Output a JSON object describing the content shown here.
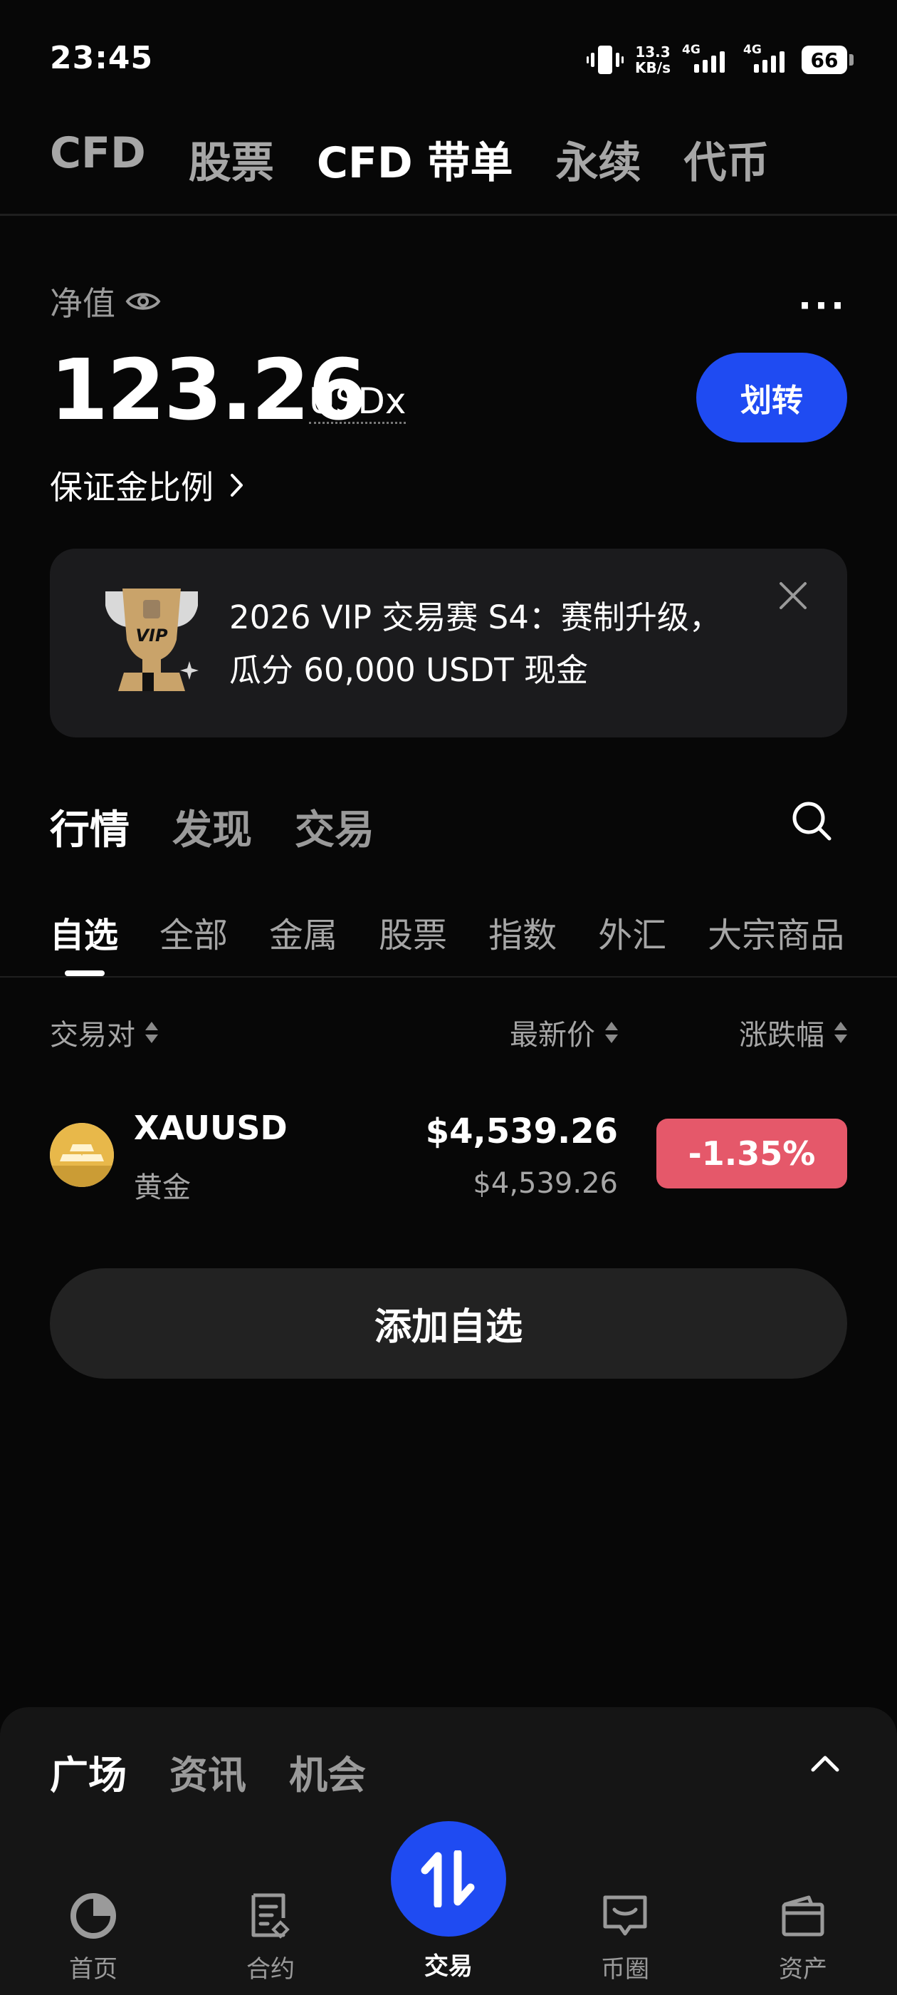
{
  "status_bar": {
    "time": "23:45",
    "net_speed_value": "13.3",
    "net_speed_unit": "KB/s",
    "signal1_label": "4G",
    "signal2_label": "4G",
    "battery": "66"
  },
  "top_tabs": [
    "CFD",
    "股票",
    "CFD 带单",
    "永续",
    "代币"
  ],
  "top_tabs_active": "CFD 带单",
  "account": {
    "equity_label": "净值",
    "equity_value": "123.26",
    "equity_unit": "USDx",
    "transfer_label": "划转",
    "margin_ratio_label": "保证金比例",
    "more_label": "···"
  },
  "banner": {
    "line1": "2026 VIP 交易赛 S4：赛制升级，",
    "line2": "瓜分 60,000 USDT 现金",
    "badge_text": "VIP"
  },
  "market_tabs": [
    "行情",
    "发现",
    "交易"
  ],
  "market_tabs_active": "行情",
  "sub_tabs": [
    "自选",
    "全部",
    "金属",
    "股票",
    "指数",
    "外汇",
    "大宗商品"
  ],
  "sub_tabs_active": "自选",
  "columns": {
    "pair": "交易对",
    "last_price": "最新价",
    "change": "涨跌幅"
  },
  "rows": [
    {
      "symbol": "XAUUSD",
      "name": "黄金",
      "price": "$4,539.26",
      "price_secondary": "$4,539.26",
      "change": "-1.35%",
      "icon": "gold-bars-icon"
    }
  ],
  "add_watchlist_label": "添加自选",
  "bottom_sheet_tabs": [
    "广场",
    "资讯",
    "机会"
  ],
  "bottom_sheet_active": "广场",
  "bottom_nav": {
    "home": "首页",
    "contracts": "合约",
    "trade": "交易",
    "community": "币圈",
    "assets": "资产"
  },
  "colors": {
    "accent": "#1f4bf2",
    "negative": "#e5586a",
    "background": "#070707"
  }
}
